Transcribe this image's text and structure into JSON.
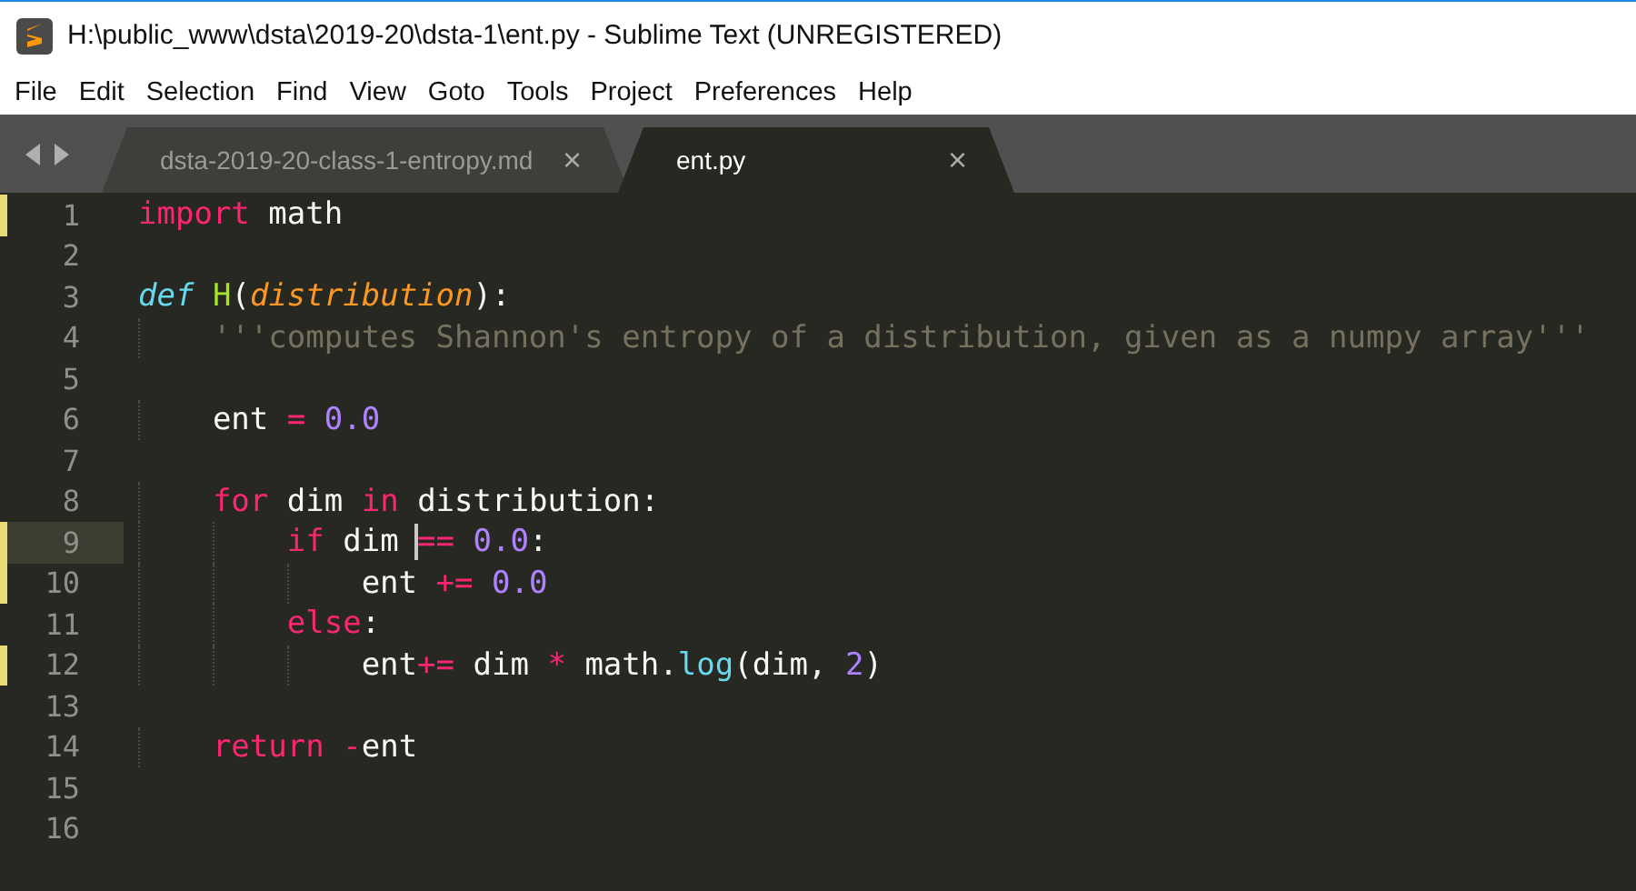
{
  "window": {
    "title": "H:\\public_www\\dsta\\2019-20\\dsta-1\\ent.py - Sublime Text (UNREGISTERED)"
  },
  "menu": [
    "File",
    "Edit",
    "Selection",
    "Find",
    "View",
    "Goto",
    "Tools",
    "Project",
    "Preferences",
    "Help"
  ],
  "tabs": [
    {
      "label": "dsta-2019-20-class-1-entropy.md",
      "selected": false,
      "close": "×"
    },
    {
      "label": "ent.py",
      "selected": true,
      "close": "×"
    }
  ],
  "lines": [
    {
      "number": "1",
      "modified": true,
      "current": false,
      "tokens": [
        {
          "kind": "keyword",
          "text": "import"
        },
        {
          "kind": "plain",
          "text": " math"
        }
      ]
    },
    {
      "number": "2",
      "modified": false,
      "current": false
    },
    {
      "number": "3",
      "modified": false,
      "current": false,
      "tokens": [
        {
          "kind": "storage",
          "text": "def"
        },
        {
          "kind": "function",
          "text": " H"
        },
        {
          "kind": "plain",
          "text": "("
        },
        {
          "kind": "parameter",
          "text": "distribution"
        },
        {
          "kind": "plain",
          "text": "):"
        }
      ]
    },
    {
      "number": "4",
      "modified": false,
      "current": false,
      "tokens": [
        {
          "kind": "string",
          "text": "    '''computes Shannon's entropy of a distribution, given as a numpy array'''"
        }
      ]
    },
    {
      "number": "5",
      "modified": false,
      "current": false
    },
    {
      "number": "6",
      "modified": false,
      "current": false,
      "tokens": [
        {
          "kind": "plain",
          "text": "    ent "
        },
        {
          "kind": "operator",
          "text": "="
        },
        {
          "kind": "number",
          "text": " 0.0"
        }
      ]
    },
    {
      "number": "7",
      "modified": false,
      "current": false
    },
    {
      "number": "8",
      "modified": false,
      "current": false,
      "tokens": [
        {
          "kind": "keyword",
          "text": "    for"
        },
        {
          "kind": "plain",
          "text": " dim "
        },
        {
          "kind": "keyword",
          "text": "in"
        },
        {
          "kind": "plain",
          "text": " distribution:"
        }
      ]
    },
    {
      "number": "9",
      "modified": true,
      "current": true,
      "tokens": [
        {
          "kind": "keyword",
          "text": "        if"
        },
        {
          "kind": "plain",
          "text": " dim "
        },
        {
          "kind": "operator",
          "text": "==",
          "caret": true
        },
        {
          "kind": "number",
          "text": " 0.0"
        },
        {
          "kind": "plain",
          "text": ":"
        }
      ]
    },
    {
      "number": "10",
      "modified": true,
      "current": false,
      "tokens": [
        {
          "kind": "plain",
          "text": "            ent "
        },
        {
          "kind": "operator",
          "text": "+="
        },
        {
          "kind": "number",
          "text": " 0.0"
        }
      ]
    },
    {
      "number": "11",
      "modified": false,
      "current": false,
      "tokens": [
        {
          "kind": "keyword",
          "text": "        else"
        },
        {
          "kind": "plain",
          "text": ":"
        }
      ]
    },
    {
      "number": "12",
      "modified": true,
      "current": false,
      "tokens": [
        {
          "kind": "plain",
          "text": "            ent"
        },
        {
          "kind": "operator",
          "text": "+="
        },
        {
          "kind": "plain",
          "text": " dim "
        },
        {
          "kind": "operator",
          "text": "*"
        },
        {
          "kind": "plain",
          "text": " math."
        },
        {
          "kind": "builtin",
          "text": "log"
        },
        {
          "kind": "plain",
          "text": "(dim, "
        },
        {
          "kind": "number",
          "text": "2"
        },
        {
          "kind": "plain",
          "text": ")"
        }
      ]
    },
    {
      "number": "13",
      "modified": false,
      "current": false
    },
    {
      "number": "14",
      "modified": false,
      "current": false,
      "tokens": [
        {
          "kind": "keyword",
          "text": "    return"
        },
        {
          "kind": "operator",
          "text": " -"
        },
        {
          "kind": "plain",
          "text": "ent"
        }
      ]
    },
    {
      "number": "15",
      "modified": false,
      "current": false
    },
    {
      "number": "16",
      "modified": false,
      "current": false
    }
  ]
}
